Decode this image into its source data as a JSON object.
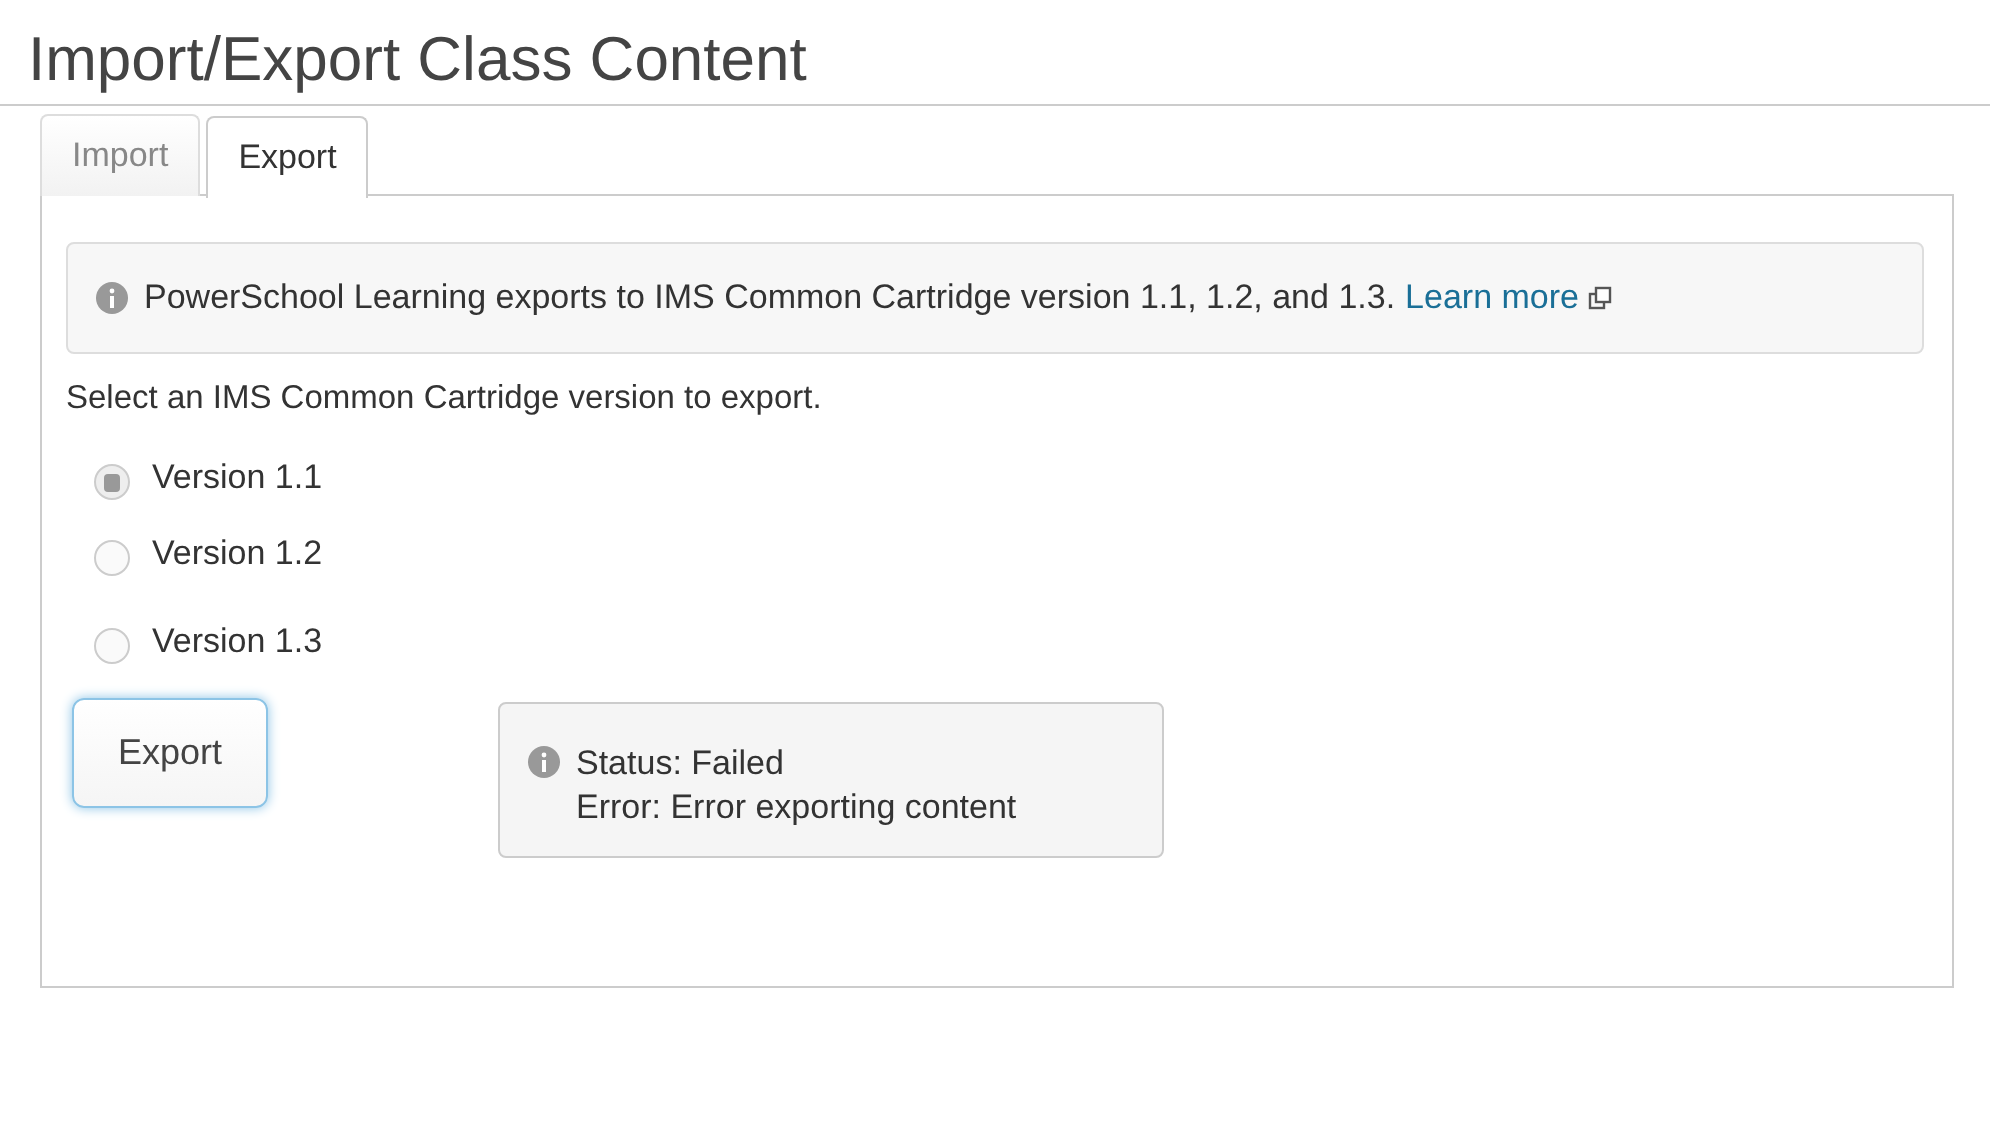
{
  "title": "Import/Export Class Content",
  "tabs": [
    {
      "label": "Import",
      "selected": false
    },
    {
      "label": "Export",
      "selected": true
    }
  ],
  "notice": {
    "text": "PowerSchool Learning exports to IMS Common Cartridge version 1.1, 1.2, and 1.3.",
    "link": "Learn more"
  },
  "prompt": "Select an IMS Common Cartridge version to export.",
  "versions": [
    {
      "label": "Version 1.1",
      "selected": true
    },
    {
      "label": "Version 1.2",
      "selected": false
    },
    {
      "label": "Version 1.3",
      "selected": false
    }
  ],
  "export_button": "Export",
  "status": {
    "lines": [
      "Status: Failed",
      "Error: Error exporting content"
    ]
  }
}
